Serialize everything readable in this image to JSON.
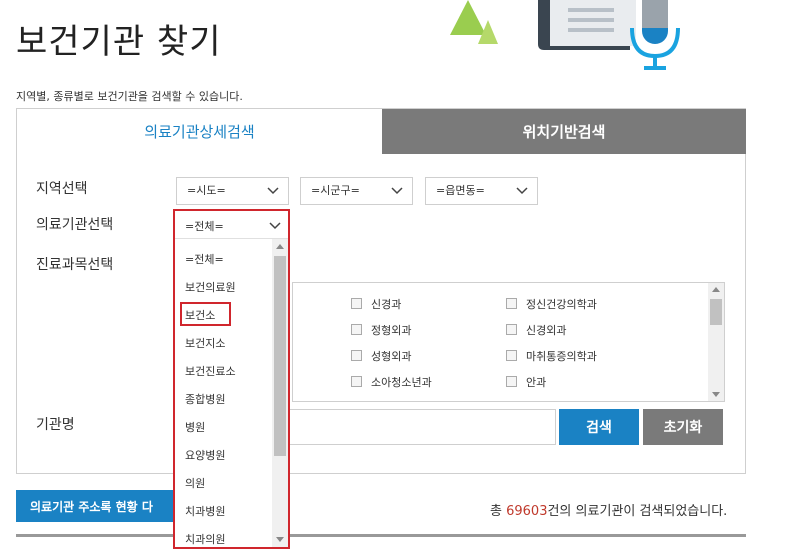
{
  "header": {
    "title": "보건기관 찾기",
    "description": "지역별, 종류별로 보건기관을 검색할 수 있습니다."
  },
  "tabs": [
    {
      "label": "의료기관상세검색",
      "active": true
    },
    {
      "label": "위치기반검색",
      "active": false
    }
  ],
  "form": {
    "region_label": "지역선택",
    "sido": "=시도=",
    "sigungu": "=시군구=",
    "eupmyeon": "=읍면동=",
    "type_label": "의료기관선택",
    "type_selected": "=전체=",
    "dept_label": "진료과목선택",
    "name_label": "기관명",
    "search_button": "검색",
    "reset_button": "초기화"
  },
  "departments": [
    [
      "신경과",
      "정신건강의학과"
    ],
    [
      "정형외과",
      "신경외과"
    ],
    [
      "성형외과",
      "마취통증의학과"
    ],
    [
      "소아청소년과",
      "안과"
    ]
  ],
  "dropdown": {
    "options": [
      "=전체=",
      "보건의료원",
      "보건소",
      "보건지소",
      "보건진료소",
      "종합병원",
      "병원",
      "요양병원",
      "의원",
      "치과병원",
      "치과의원"
    ],
    "highlighted": "보건소"
  },
  "footer": {
    "address_button": "의료기관 주소록 현황 다",
    "result_prefix": "총",
    "result_count": "69603",
    "result_suffix": "건의 의료기관이 검색되었습니다."
  },
  "colors": {
    "accent": "#1a82c4",
    "tab_inactive": "#7a7a7a",
    "highlight": "#d0262d"
  }
}
